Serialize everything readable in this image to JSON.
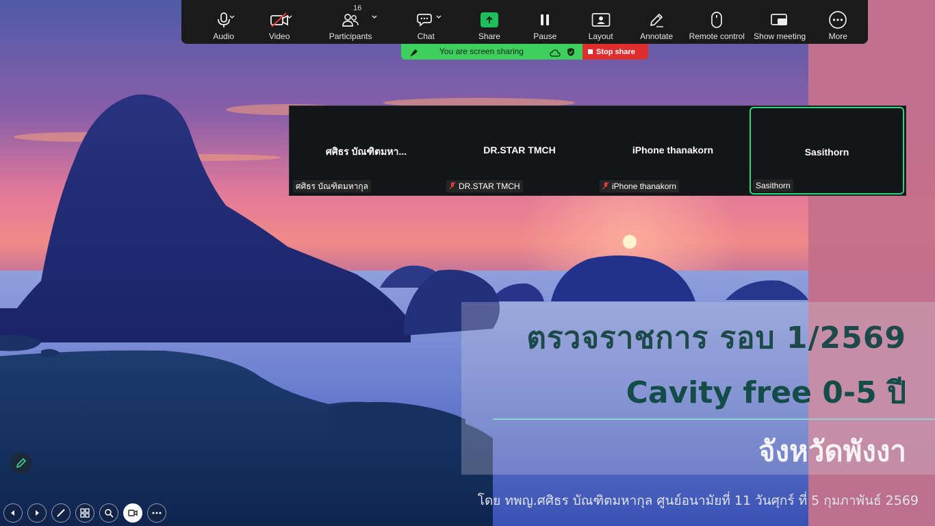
{
  "toolbar": {
    "audio": {
      "label": "Audio",
      "icon": "microphone-icon"
    },
    "video": {
      "label": "Video",
      "icon": "video-off-icon"
    },
    "participants": {
      "label": "Participants",
      "count": "16",
      "icon": "participants-icon"
    },
    "chat": {
      "label": "Chat",
      "icon": "chat-icon"
    },
    "share": {
      "label": "Share",
      "icon": "share-screen-icon",
      "color": "#1ebf5a"
    },
    "pause": {
      "label": "Pause",
      "icon": "pause-icon"
    },
    "layout": {
      "label": "Layout",
      "icon": "layout-icon"
    },
    "annotate": {
      "label": "Annotate",
      "icon": "pen-icon"
    },
    "remote_control": {
      "label": "Remote control",
      "icon": "mouse-icon"
    },
    "show_meeting": {
      "label": "Show meeting",
      "icon": "show-meeting-icon"
    },
    "more": {
      "label": "More",
      "icon": "more-icon"
    }
  },
  "sharing_bar": {
    "status": "You are screen sharing",
    "stop_label": "Stop share",
    "color": "#3fcf5e",
    "stop_color": "#e02e2e"
  },
  "participants": [
    {
      "display_name": "ศศิธร บัณฑิตมหา...",
      "tag": "ศศิธร บัณฑิตมหากุล",
      "muted": false,
      "active": false
    },
    {
      "display_name": "DR.STAR TMCH",
      "tag": "DR.STAR TMCH",
      "muted": true,
      "active": false
    },
    {
      "display_name": "iPhone thanakorn",
      "tag": "iPhone thanakorn",
      "muted": true,
      "active": false
    },
    {
      "display_name": "Sasithorn",
      "tag": "Sasithorn",
      "muted": false,
      "active": true
    }
  ],
  "slide": {
    "title_line1": "ตรวจราชการ รอบ 1/2569",
    "title_line2": "Cavity free 0-5 ปี",
    "title_line3": "จังหวัดพังงา",
    "byline": "โดย ทพญ.ศศิธร บัณฑิตมหากุล ศูนย์อนามัยที่ 11 วันศุกร์ ที่ 5 กุมภาพันธ์ 2569",
    "accent_color": "#134c48"
  },
  "presentation_controls": [
    "previous-icon",
    "next-icon",
    "pen-icon",
    "slides-grid-icon",
    "zoom-icon",
    "camera-icon",
    "more-icon"
  ]
}
